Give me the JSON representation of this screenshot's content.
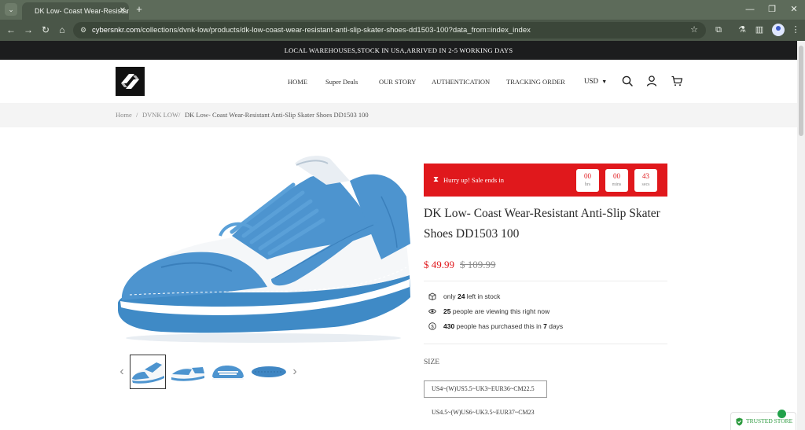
{
  "browser": {
    "tab_title": "DK Low- Coast Wear-Resistant",
    "url_host": "cybersnkr.com",
    "url_path": "/collections/dvnk-low/products/dk-low-coast-wear-resistant-anti-slip-skater-shoes-dd1503-100?data_from=index_index"
  },
  "announcement": "LOCAL WAREHOUSES,STOCK IN USA,ARRIVED IN 2-5 WORKING DAYS",
  "nav": {
    "home": "HOME",
    "deals": "Super Deals",
    "story": "OUR STORY",
    "auth": "AUTHENTICATION",
    "tracking": "TRACKING ORDER",
    "currency": "USD"
  },
  "breadcrumb": {
    "home": "Home",
    "sep": "/",
    "collection": "DVNK LOW",
    "current": "DK Low- Coast Wear-Resistant Anti-Slip Skater Shoes DD1503 100"
  },
  "sale": {
    "label": "Hurry up!  Sale ends in",
    "hrs": "00",
    "hrs_unit": "hrs",
    "mins": "00",
    "mins_unit": "mins",
    "secs": "43",
    "secs_unit": "secs"
  },
  "product": {
    "title": "DK Low- Coast Wear-Resistant Anti-Slip Skater Shoes DD1503 100",
    "price": "$ 49.99",
    "compare_price": "$ 109.99",
    "stock_pre": "only ",
    "stock_count": "24",
    "stock_post": " left in stock",
    "viewers": "25",
    "viewers_post": " people are viewing this right now",
    "purchased": "430",
    "purchased_mid": " people has purchased this in ",
    "purchased_days": "7",
    "purchased_post": " days"
  },
  "size": {
    "label": "SIZE",
    "selected": "US4~(W)US5.5~UK3~EUR36~CM22.5",
    "next": "US4.5~(W)US6~UK3.5~EUR37~CM23"
  },
  "trusted": "TRUSTED STORE",
  "colors": {
    "accent_red": "#e0181c",
    "shoe_blue": "#4d94cf",
    "chrome_green": "#5d6b5a"
  }
}
